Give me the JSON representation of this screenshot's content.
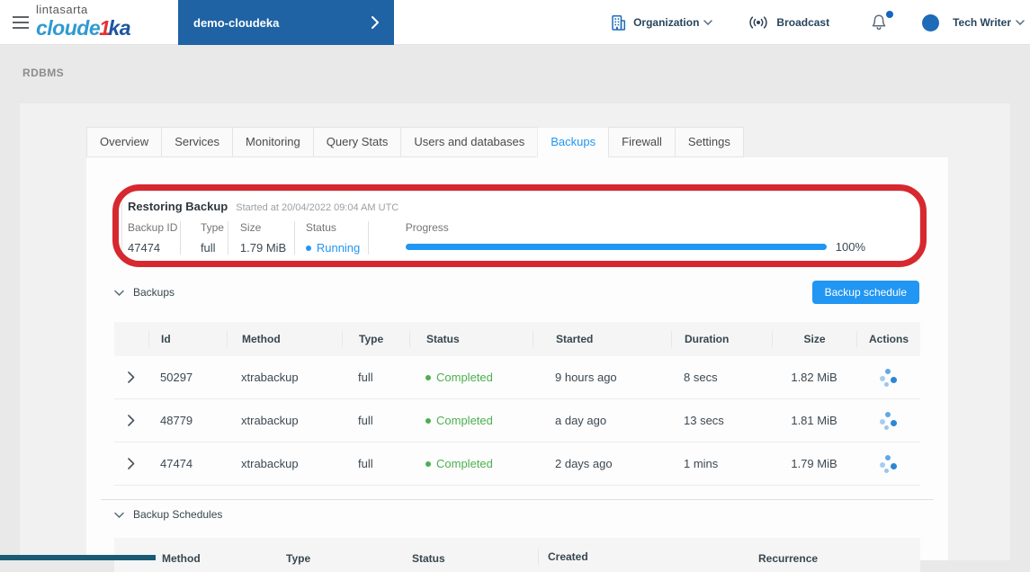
{
  "header": {
    "brand": {
      "company": "lintasarta",
      "product_light": "cloude",
      "product_accent": "1",
      "product_dark": "ka"
    },
    "project": {
      "name": "demo-cloudeka"
    },
    "nav": {
      "organization": "Organization",
      "broadcast": "Broadcast",
      "user": "Tech Writer"
    }
  },
  "breadcrumb": "RDBMS",
  "tabs": [
    {
      "label": "Overview"
    },
    {
      "label": "Services"
    },
    {
      "label": "Monitoring"
    },
    {
      "label": "Query Stats"
    },
    {
      "label": "Users and databases"
    },
    {
      "label": "Backups",
      "active": true
    },
    {
      "label": "Firewall"
    },
    {
      "label": "Settings"
    }
  ],
  "restoring": {
    "title": "Restoring Backup",
    "started": "Started at 20/04/2022 09:04 AM UTC",
    "fields": [
      {
        "label": "Backup ID",
        "value": "47474"
      },
      {
        "label": "Type",
        "value": "full"
      },
      {
        "label": "Size",
        "value": "1.79 MiB"
      },
      {
        "label": "Status",
        "value": "Running"
      }
    ],
    "progress": {
      "label": "Progress",
      "percent": 100,
      "text": "100%"
    }
  },
  "backups": {
    "title": "Backups",
    "schedule_button": "Backup schedule",
    "columns": [
      "Id",
      "Method",
      "Type",
      "Status",
      "Started",
      "Duration",
      "Size",
      "Actions"
    ],
    "rows": [
      {
        "id": "50297",
        "method": "xtrabackup",
        "type": "full",
        "status": "Completed",
        "started": "9 hours ago",
        "duration": "8 secs",
        "size": "1.82 MiB"
      },
      {
        "id": "48779",
        "method": "xtrabackup",
        "type": "full",
        "status": "Completed",
        "started": "a day ago",
        "duration": "13 secs",
        "size": "1.81 MiB"
      },
      {
        "id": "47474",
        "method": "xtrabackup",
        "type": "full",
        "status": "Completed",
        "started": "2 days ago",
        "duration": "1 mins",
        "size": "1.79 MiB"
      }
    ]
  },
  "schedules": {
    "title": "Backup Schedules",
    "columns": [
      "Method",
      "Type",
      "Status",
      "Created",
      "Recurrence"
    ]
  },
  "colors": {
    "accent_blue": "#2196f3",
    "brand_bar_blue": "#1f63a5",
    "annotation_red": "#d7282f",
    "success_green": "#4caf50",
    "running_blue": "#2196f3"
  }
}
